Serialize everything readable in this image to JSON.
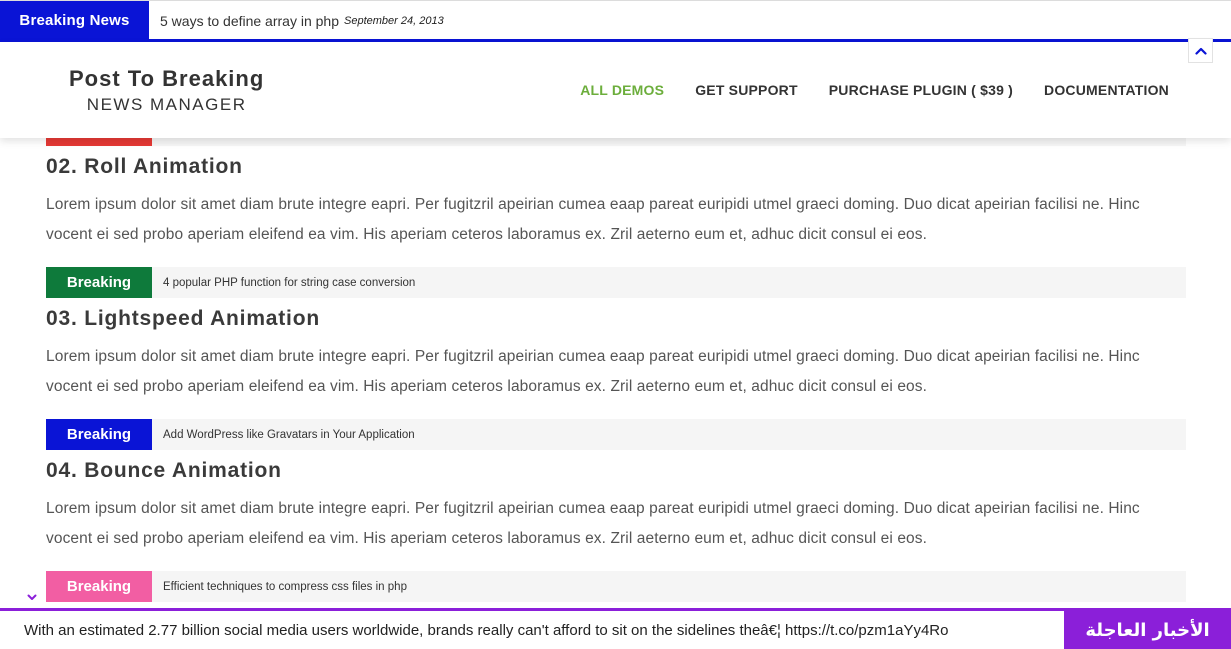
{
  "top_ticker": {
    "label": "Breaking News",
    "headline": "5 ways to define array in php",
    "date": "September 24, 2013",
    "color": "#0a14d6"
  },
  "logo": {
    "line1": "Post To Breaking",
    "line2": "NEWS MANAGER"
  },
  "nav": {
    "items": [
      "ALL DEMOS",
      "GET SUPPORT",
      "PURCHASE PLUGIN ( $39 )",
      "DOCUMENTATION"
    ],
    "active_color": "#6cae3c"
  },
  "sections": [
    {
      "title": "02. Roll Animation",
      "body": "Lorem ipsum dolor sit amet diam brute integre eapri. Per fugitzril apeirian cumea eaap pareat euripidi utmel graeci doming. Duo dicat apeirian facilisi ne. Hinc vocent ei sed probo aperiam eleifend ea vim. His aperiam ceteros laboramus ex. Zril aeterno eum et, adhuc dicit consul ei eos.",
      "bar": {
        "label": "Breaking",
        "text": "4 popular PHP function for string case conversion",
        "color": "#0e7a3b"
      }
    },
    {
      "title": "03. Lightspeed Animation",
      "body": "Lorem ipsum dolor sit amet diam brute integre eapri. Per fugitzril apeirian cumea eaap pareat euripidi utmel graeci doming. Duo dicat apeirian facilisi ne. Hinc vocent ei sed probo aperiam eleifend ea vim. His aperiam ceteros laboramus ex. Zril aeterno eum et, adhuc dicit consul ei eos.",
      "bar": {
        "label": "Breaking",
        "text": "Add WordPress like Gravatars in Your Application",
        "color": "#0a14d6"
      }
    },
    {
      "title": "04. Bounce Animation",
      "body": "Lorem ipsum dolor sit amet diam brute integre eapri. Per fugitzril apeirian cumea eaap pareat euripidi utmel graeci doming. Duo dicat apeirian facilisi ne. Hinc vocent ei sed probo aperiam eleifend ea vim. His aperiam ceteros laboramus ex. Zril aeterno eum et, adhuc dicit consul ei eos.",
      "bar": {
        "label": "Breaking",
        "text": "Efficient techniques to compress css files in php",
        "color": "#f25ea3"
      }
    }
  ],
  "partial_bar_color": "#e53935",
  "bottom_ticker": {
    "text": "With an estimated 2.77 billion social media users worldwide, brands really can't afford to sit on the sidelines theâ€¦ https://t.co/pzm1aYy4Ro",
    "label": "الأخبار العاجلة",
    "color": "#8b1fd9"
  },
  "icons": {
    "scroll_top": "chevron-up-icon",
    "collapse": "chevron-down-icon"
  }
}
